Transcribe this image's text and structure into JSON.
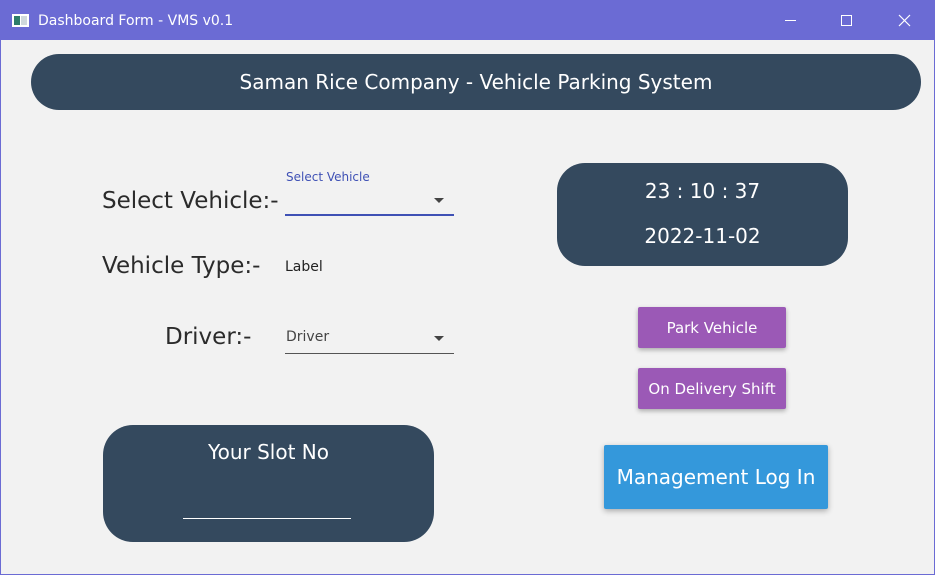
{
  "window": {
    "title": "Dashboard Form - VMS v0.1",
    "colors": {
      "titlebar": "#6b6bd4",
      "panel": "#34495e",
      "purple_button": "#9b59b6",
      "blue_button": "#3498db"
    }
  },
  "header": {
    "title": "Saman Rice Company - Vehicle Parking System"
  },
  "form": {
    "vehicle_label": "Select Vehicle:-",
    "vehicle_float_label": "Select Vehicle",
    "vehicle_value": "",
    "type_label": "Vehicle Type:-",
    "type_value": "Label",
    "driver_label": "Driver:-",
    "driver_value": "Driver"
  },
  "clock": {
    "time": "23 : 10 : 37",
    "date": "2022-11-02"
  },
  "actions": {
    "park_label": "Park Vehicle",
    "delivery_label": "On Delivery Shift",
    "management_label": "Management Log In"
  },
  "slot": {
    "title": "Your Slot No",
    "value": ""
  }
}
